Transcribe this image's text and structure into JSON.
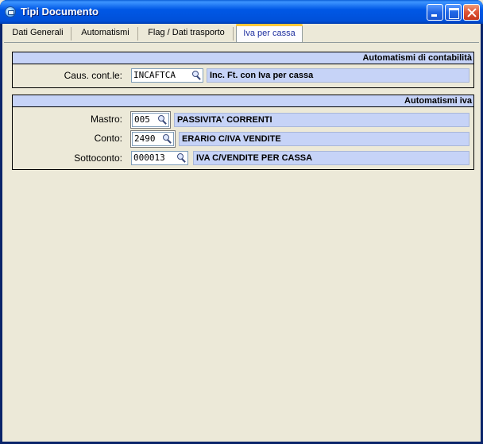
{
  "window": {
    "title": "Tipi Documento"
  },
  "tabs": [
    {
      "label": "Dati Generali"
    },
    {
      "label": "Automatismi"
    },
    {
      "label": "Flag / Dati trasporto"
    },
    {
      "label": "Iva per cassa"
    }
  ],
  "active_tab": "Iva per cassa",
  "contabilita": {
    "header": "Automatismi di contabilità",
    "causale": {
      "label": "Caus. cont.le:",
      "code": "INCAFTCA",
      "description": "Inc. Ft. con Iva per cassa"
    }
  },
  "iva": {
    "header": "Automatismi iva",
    "mastro": {
      "label": "Mastro:",
      "code": "005",
      "description": "PASSIVITA' CORRENTI"
    },
    "conto": {
      "label": "Conto:",
      "code": "2490",
      "description": "ERARIO C/IVA VENDITE"
    },
    "sottoconto": {
      "label": "Sottoconto:",
      "code": "000013",
      "description": "IVA C/VENDITE PER CASSA"
    }
  },
  "icons": [
    "app-icon",
    "minimize-icon",
    "maximize-icon",
    "close-icon",
    "zoom-icon"
  ]
}
